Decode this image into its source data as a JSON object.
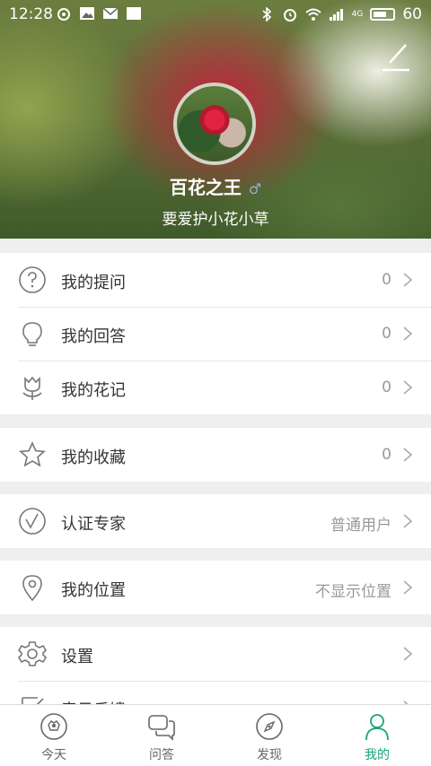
{
  "status_bar": {
    "time": "12:28",
    "carrier_tag": "4G",
    "battery": "60"
  },
  "profile": {
    "nickname": "百花之王",
    "gender_symbol": "♂",
    "signature": "要爱护小花小草"
  },
  "menu_groups": [
    [
      {
        "icon": "question-icon",
        "label": "我的提问",
        "value": "0"
      },
      {
        "icon": "lightbulb-icon",
        "label": "我的回答",
        "value": "0"
      },
      {
        "icon": "tulip-icon",
        "label": "我的花记",
        "value": "0"
      }
    ],
    [
      {
        "icon": "star-icon",
        "label": "我的收藏",
        "value": "0"
      }
    ],
    [
      {
        "icon": "verified-icon",
        "label": "认证专家",
        "value": "普通用户"
      }
    ],
    [
      {
        "icon": "location-pin-icon",
        "label": "我的位置",
        "value": "不显示位置"
      }
    ],
    [
      {
        "icon": "gear-icon",
        "label": "设置",
        "value": ""
      },
      {
        "icon": "feedback-icon",
        "label": "意见反馈",
        "value": ""
      }
    ]
  ],
  "tabs": [
    {
      "icon": "flower-circle-icon",
      "label": "今天"
    },
    {
      "icon": "chat-bubbles-icon",
      "label": "问答"
    },
    {
      "icon": "compass-icon",
      "label": "发现"
    },
    {
      "icon": "person-icon",
      "label": "我的",
      "active": true
    }
  ],
  "colors": {
    "accent": "#1aa37a",
    "gender": "#8fb1dd"
  }
}
